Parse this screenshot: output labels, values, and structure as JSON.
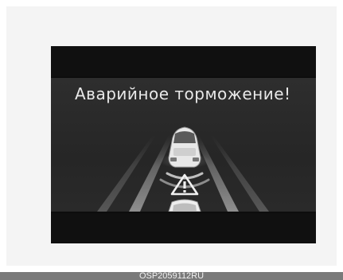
{
  "display": {
    "warning_message": "Аварийное торможение!"
  },
  "icons": {
    "lead_vehicle": "car-rear-view-icon",
    "warning": "warning-triangle-icon",
    "own_vehicle": "car-front-icon"
  },
  "colors": {
    "screen_bg": "#2a2a2a",
    "text": "#e9e9e9",
    "frame_bg": "#f4f4f4"
  },
  "caption": {
    "code": "OSP2059112RU"
  }
}
